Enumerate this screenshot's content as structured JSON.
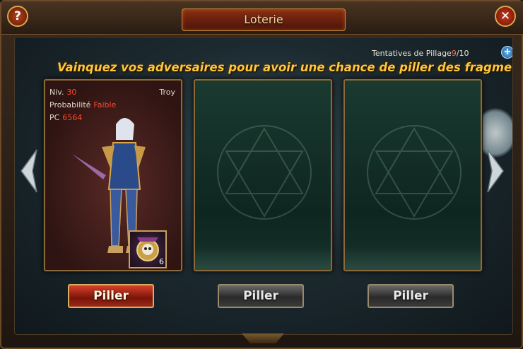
{
  "window": {
    "title": "Loterie"
  },
  "header": {
    "attempts_label": "Tentatives de Pillage",
    "attempts_used": "9",
    "attempts_total": "/10"
  },
  "banner": "Vainquez vos adversaires pour avoir une chance de piller des fragments !",
  "enemy": {
    "level_label": "Niv.",
    "level": "30",
    "server": "Troy",
    "prob_label": "Probabilité",
    "prob": "Faible",
    "pc_label": "PC",
    "pc": "6564",
    "item_count": "6"
  },
  "buttons": [
    "Piller",
    "Piller",
    "Piller"
  ],
  "icons": {
    "help": "?",
    "close": "✕",
    "plus": "+"
  },
  "colors": {
    "accent": "#ffc83a",
    "highlight": "#ff4a2a",
    "frame": "#8a6a3a"
  }
}
